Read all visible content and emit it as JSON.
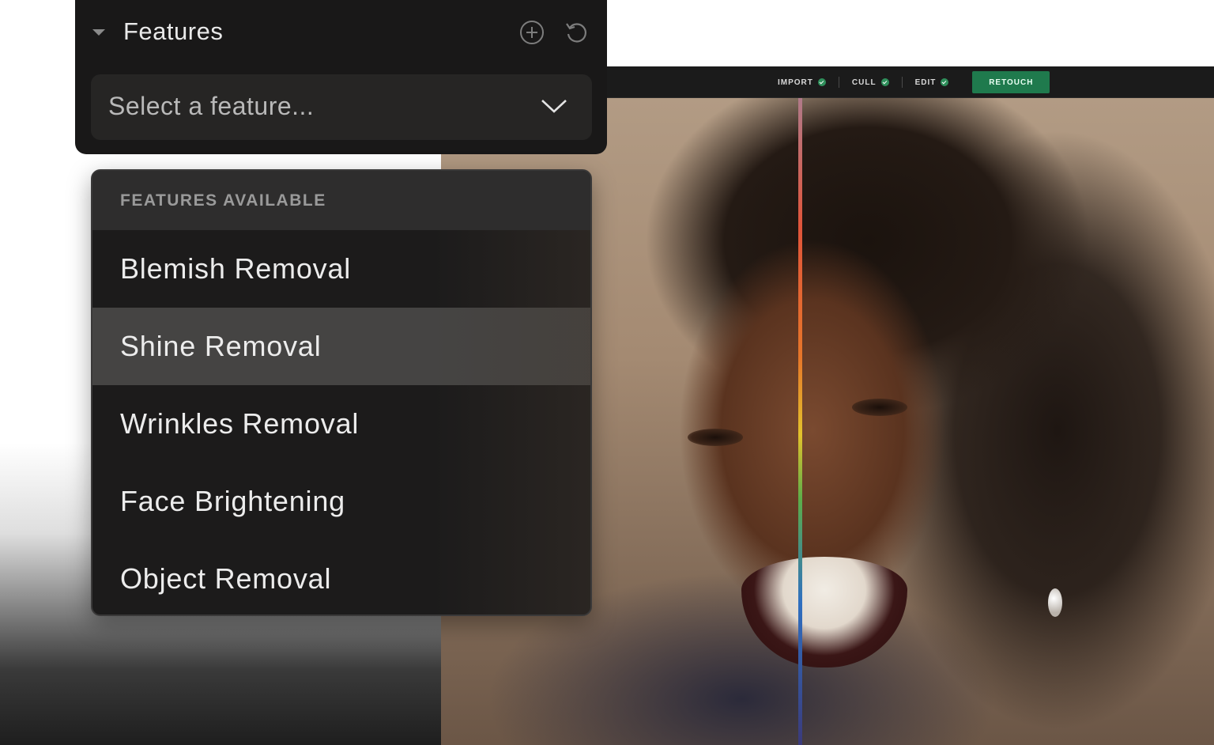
{
  "features_panel": {
    "title": "Features",
    "add_icon": "plus-circle-icon",
    "reset_icon": "undo-icon",
    "select_placeholder": "Select a feature..."
  },
  "dropdown": {
    "header": "FEATURES AVAILABLE",
    "options": [
      {
        "label": "Blemish Removal",
        "selected": false
      },
      {
        "label": "Shine Removal",
        "selected": true
      },
      {
        "label": "Wrinkles Removal",
        "selected": false
      },
      {
        "label": "Face Brightening",
        "selected": false
      },
      {
        "label": "Object Removal",
        "selected": false
      }
    ]
  },
  "editor": {
    "steps": [
      {
        "label": "IMPORT",
        "done": true
      },
      {
        "label": "CULL",
        "done": true
      },
      {
        "label": "EDIT",
        "done": true
      }
    ],
    "active_step": "RETOUCH",
    "accent_color": "#1f7a4d"
  }
}
